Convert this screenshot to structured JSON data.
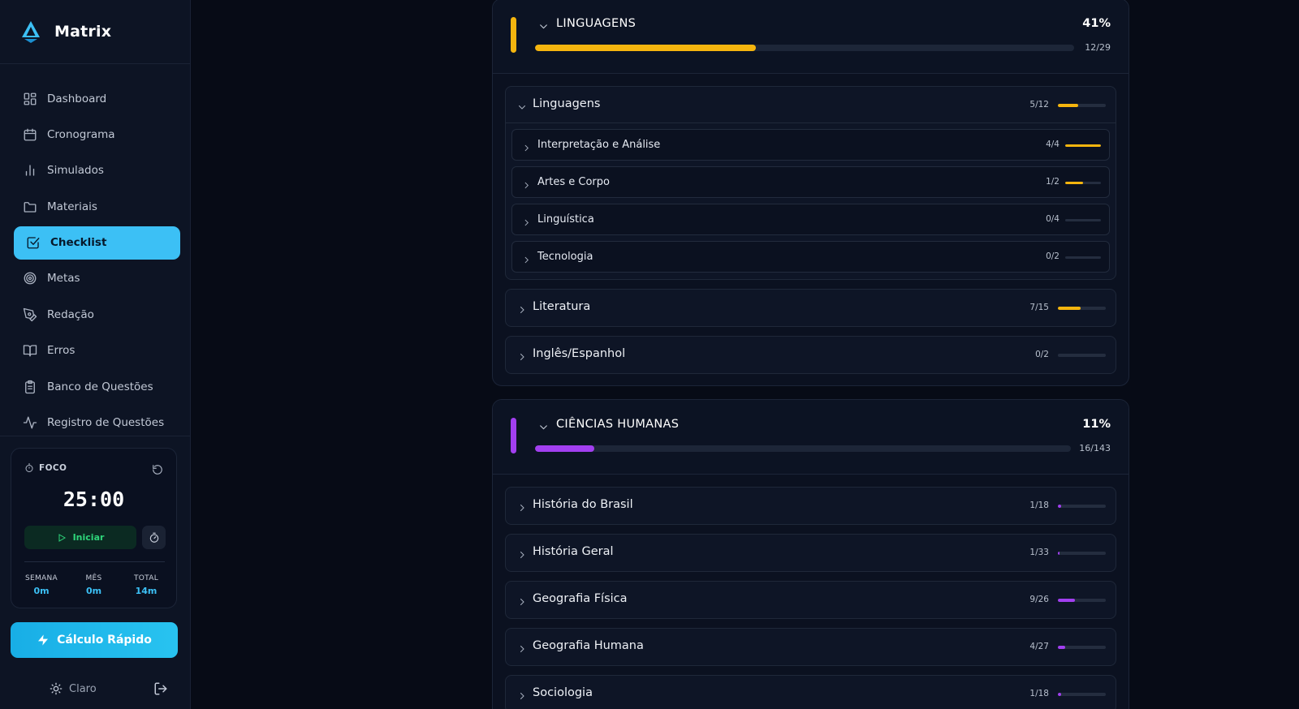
{
  "app": {
    "name": "Matrix"
  },
  "colors": {
    "accent": "#3cc0f5",
    "linguagens": "#f5b50e",
    "humanas": "#a23ff0",
    "success": "#2ed47a"
  },
  "sidebar": {
    "items": [
      {
        "label": "Dashboard",
        "icon": "dashboard-icon"
      },
      {
        "label": "Cronograma",
        "icon": "calendar-icon"
      },
      {
        "label": "Simulados",
        "icon": "bar-chart-icon"
      },
      {
        "label": "Materiais",
        "icon": "folder-icon"
      },
      {
        "label": "Checklist",
        "icon": "checkbox-icon",
        "active": true
      },
      {
        "label": "Metas",
        "icon": "target-icon"
      },
      {
        "label": "Redação",
        "icon": "pen-icon"
      },
      {
        "label": "Erros",
        "icon": "book-icon"
      },
      {
        "label": "Banco de Questões",
        "icon": "clipboard-icon"
      },
      {
        "label": "Registro de Questões",
        "icon": "activity-icon"
      }
    ]
  },
  "focus": {
    "title": "FOCO",
    "timer": "25:00",
    "start_label": "Iniciar",
    "stats": [
      {
        "label": "SEMANA",
        "value": "0m"
      },
      {
        "label": "MÊS",
        "value": "0m"
      },
      {
        "label": "TOTAL",
        "value": "14m"
      }
    ]
  },
  "quick_calc": {
    "label": "Cálculo Rápido"
  },
  "theme": {
    "label": "Claro"
  },
  "areas": [
    {
      "title": "LINGUAGENS",
      "percent": "41%",
      "count": "12/29",
      "progress": 0.41,
      "subjects": [
        {
          "name": "Linguagens",
          "count": "5/12",
          "progress": 0.42,
          "expanded": true,
          "topics": [
            {
              "name": "Interpretação e Análise",
              "count": "4/4",
              "progress": 1.0
            },
            {
              "name": "Artes e Corpo",
              "count": "1/2",
              "progress": 0.5
            },
            {
              "name": "Linguística",
              "count": "0/4",
              "progress": 0
            },
            {
              "name": "Tecnologia",
              "count": "0/2",
              "progress": 0
            }
          ]
        },
        {
          "name": "Literatura",
          "count": "7/15",
          "progress": 0.47
        },
        {
          "name": "Inglês/Espanhol",
          "count": "0/2",
          "progress": 0
        }
      ]
    },
    {
      "title": "CIÊNCIAS HUMANAS",
      "percent": "11%",
      "count": "16/143",
      "progress": 0.11,
      "subjects": [
        {
          "name": "História do Brasil",
          "count": "1/18",
          "progress": 0.06
        },
        {
          "name": "História Geral",
          "count": "1/33",
          "progress": 0.03
        },
        {
          "name": "Geografia Física",
          "count": "9/26",
          "progress": 0.35
        },
        {
          "name": "Geografia Humana",
          "count": "4/27",
          "progress": 0.15
        },
        {
          "name": "Sociologia",
          "count": "1/18",
          "progress": 0.06
        }
      ]
    }
  ]
}
